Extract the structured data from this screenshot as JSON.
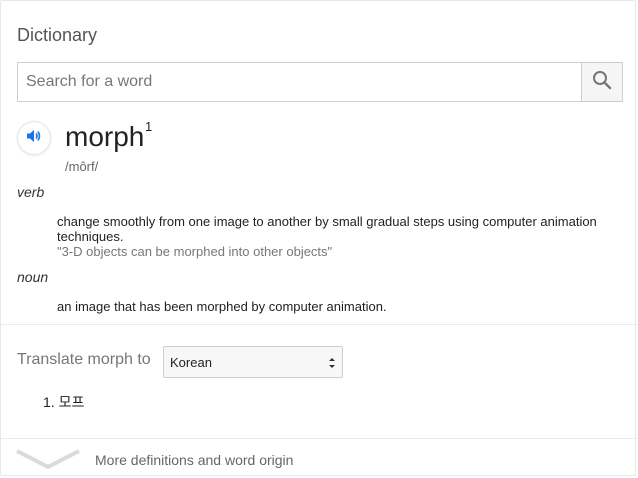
{
  "card": {
    "title": "Dictionary",
    "search": {
      "placeholder": "Search for a word"
    },
    "entry": {
      "word": "morph",
      "superscript": "1",
      "phonetic": "/môrf/",
      "senses": [
        {
          "pos": "verb",
          "definition": "change smoothly from one image to another by small gradual steps using computer animation techniques.",
          "example": "\"3-D objects can be morphed into other objects\""
        },
        {
          "pos": "noun",
          "definition": "an image that has been morphed by computer animation."
        }
      ]
    },
    "translate": {
      "label": "Translate morph to",
      "selected_language": "Korean",
      "results": [
        "1. 모프"
      ]
    },
    "more_link": "More definitions and word origin",
    "icons": {
      "search": "search-icon",
      "speaker": "speaker-icon",
      "select": "select-arrows-icon",
      "expand": "chevron-down-icon"
    },
    "colors": {
      "speaker_blue": "#1a73e8",
      "icon_gray": "#757575"
    }
  }
}
